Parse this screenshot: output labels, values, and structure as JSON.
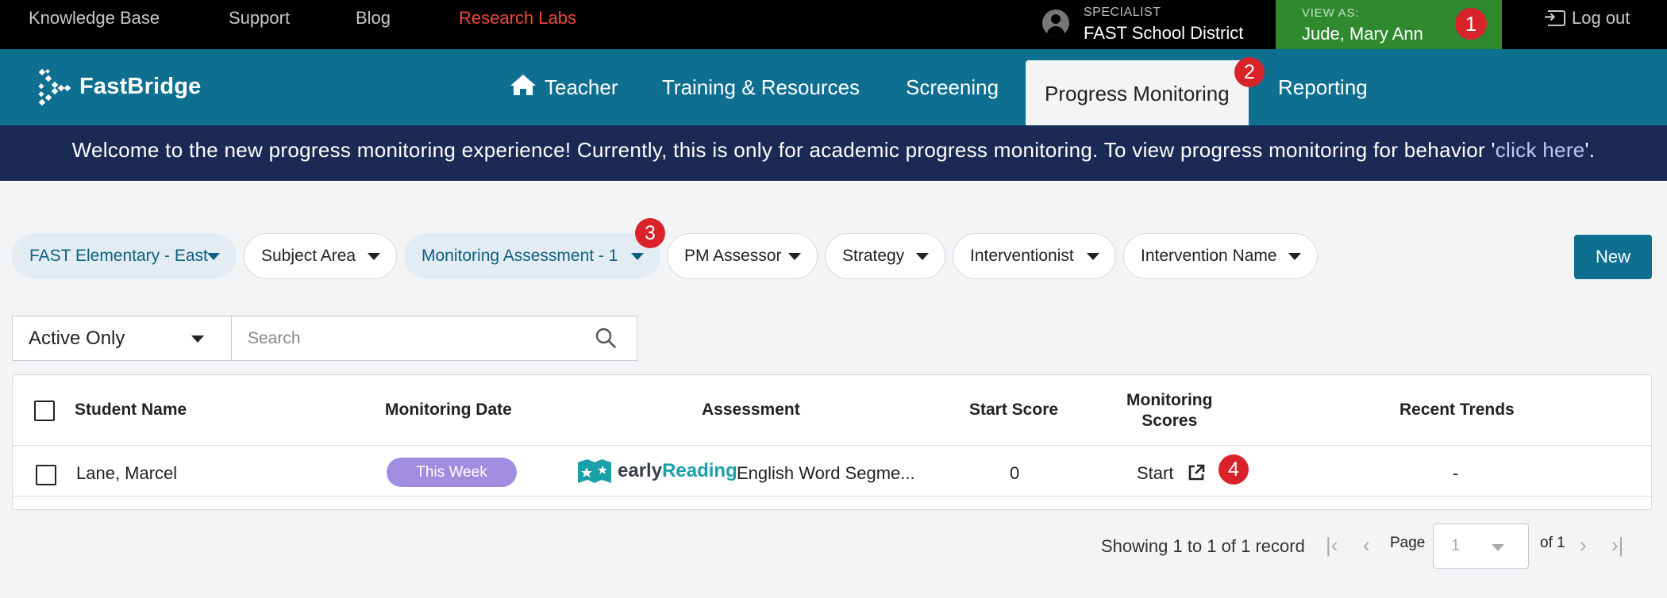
{
  "topbar": {
    "links": [
      "Knowledge Base",
      "Support",
      "Blog",
      "Research Labs"
    ],
    "specialist_label": "SPECIALIST",
    "specialist_value": "FAST School District",
    "viewas_label": "VIEW AS:",
    "viewas_value": "Jude, Mary Ann",
    "logout": "Log out"
  },
  "badges": [
    "1",
    "2",
    "3",
    "4"
  ],
  "nav": {
    "logo": "FastBridge",
    "items": [
      "Teacher",
      "Training & Resources",
      "Screening",
      "Progress Monitoring",
      "Reporting"
    ],
    "active": "Progress Monitoring"
  },
  "banner": {
    "text": "Welcome to the new progress monitoring experience! Currently, this is only for academic progress monitoring. To view progress monitoring for behavior '",
    "link": "click here",
    "end": "'."
  },
  "filters": [
    "FAST Elementary - East",
    "Subject Area",
    "Monitoring Assessment - 1",
    "PM Assessor",
    "Strategy",
    "Interventionist",
    "Intervention Name"
  ],
  "new_button": "New",
  "status_select": "Active Only",
  "search": {
    "placeholder": "Search"
  },
  "table": {
    "headers": [
      "Student Name",
      "Monitoring Date",
      "Assessment",
      "Start Score",
      "Monitoring Scores",
      "Recent Trends"
    ],
    "monitoring_scores_lines": [
      "Monitoring",
      "Scores"
    ],
    "rows": [
      {
        "student": "Lane, Marcel",
        "date_tag": "This Week",
        "assessment_brand_a": "early",
        "assessment_brand_b": "Reading",
        "assessment": "English Word Segme...",
        "start_score": "0",
        "monitoring": "Start",
        "trend": "-"
      }
    ]
  },
  "pager": {
    "info": "Showing 1 to 1 of 1 record",
    "page_label": "Page",
    "page_value": "1",
    "of": "of 1"
  },
  "colors": {
    "nav": "#0e6f91",
    "banner": "#1b2a55",
    "viewas": "#2f8a2f",
    "badge": "#d9232a",
    "research": "#f0473a"
  }
}
